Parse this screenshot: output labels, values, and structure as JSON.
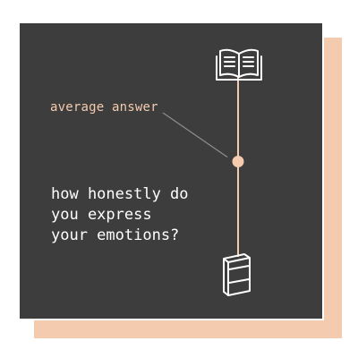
{
  "average_label": "average answer",
  "question_lines": [
    "how honestly do",
    "you express",
    "your emotions?"
  ],
  "top_icon": "open-book-icon",
  "bottom_icon": "closed-book-icon",
  "average_position": 0.47,
  "colors": {
    "background": "#3d3d3d",
    "accent": "#f4cbaf",
    "text": "#ffffff",
    "border": "#ffffff"
  }
}
